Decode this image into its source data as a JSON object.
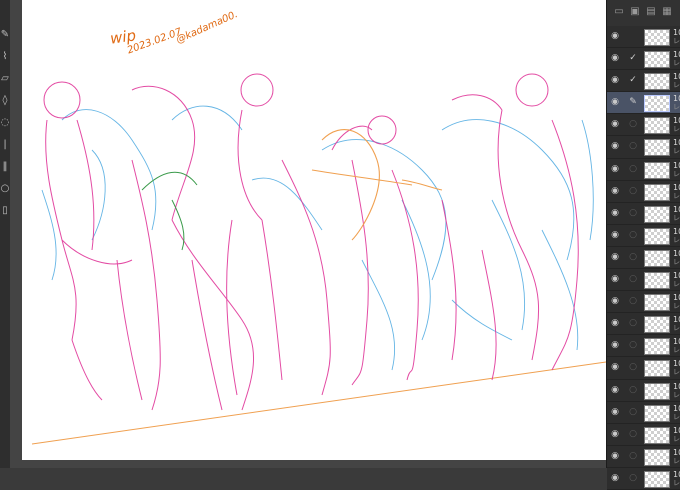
{
  "toolbar": {
    "tools": [
      {
        "icon": "pen-tool-icon",
        "glyph": "✎"
      },
      {
        "icon": "brush-tool-icon",
        "glyph": "⌇"
      },
      {
        "icon": "eraser-tool-icon",
        "glyph": "▱"
      },
      {
        "icon": "fill-tool-icon",
        "glyph": "◊"
      },
      {
        "icon": "lasso-tool-icon",
        "glyph": "◌"
      },
      {
        "icon": "ruler-tool-icon",
        "glyph": "|"
      },
      {
        "icon": "text-tool-icon",
        "glyph": "‖"
      },
      {
        "icon": "hand-tool-icon",
        "glyph": "○"
      },
      {
        "icon": "shape-tool-icon",
        "glyph": "▯"
      }
    ]
  },
  "canvas": {
    "signature": {
      "wip": "wip",
      "date": "2023.02.07",
      "handle": "@kadama00."
    },
    "colors": {
      "pink": "#e0389a",
      "blue": "#4aa8e0",
      "orange": "#f0a050",
      "green": "#3a9a4a"
    }
  },
  "layers_panel": {
    "header_icons": [
      "new-layer-icon",
      "duplicate-layer-icon",
      "folder-icon",
      "delete-layer-icon"
    ],
    "layers": [
      {
        "name": "10",
        "sub": "レ",
        "state": "none",
        "selected": false
      },
      {
        "name": "10",
        "sub": "レ",
        "state": "check",
        "selected": false
      },
      {
        "name": "10",
        "sub": "レ",
        "state": "check",
        "selected": false
      },
      {
        "name": "10",
        "sub": "レ",
        "state": "pen",
        "selected": true
      },
      {
        "name": "10",
        "sub": "レ",
        "state": "dot",
        "selected": false
      },
      {
        "name": "10",
        "sub": "レ",
        "state": "dot",
        "selected": false
      },
      {
        "name": "10",
        "sub": "レ",
        "state": "dot",
        "selected": false
      },
      {
        "name": "10",
        "sub": "レ",
        "state": "dot",
        "selected": false
      },
      {
        "name": "10",
        "sub": "レ",
        "state": "dot",
        "selected": false
      },
      {
        "name": "10",
        "sub": "レ",
        "state": "dot",
        "selected": false
      },
      {
        "name": "10",
        "sub": "レ",
        "state": "dot",
        "selected": false
      },
      {
        "name": "10",
        "sub": "レ",
        "state": "dot",
        "selected": false
      },
      {
        "name": "10",
        "sub": "レ",
        "state": "dot",
        "selected": false
      },
      {
        "name": "10",
        "sub": "レ",
        "state": "dot",
        "selected": false
      },
      {
        "name": "10",
        "sub": "レ",
        "state": "dot",
        "selected": false
      },
      {
        "name": "10",
        "sub": "レ",
        "state": "dot",
        "selected": false
      },
      {
        "name": "10",
        "sub": "レ",
        "state": "dot",
        "selected": false
      },
      {
        "name": "10",
        "sub": "レ",
        "state": "dot",
        "selected": false
      },
      {
        "name": "10",
        "sub": "レ",
        "state": "dot",
        "selected": false
      },
      {
        "name": "10",
        "sub": "レ",
        "state": "dot",
        "selected": false
      },
      {
        "name": "10",
        "sub": "レ",
        "state": "dot",
        "selected": false
      }
    ]
  }
}
